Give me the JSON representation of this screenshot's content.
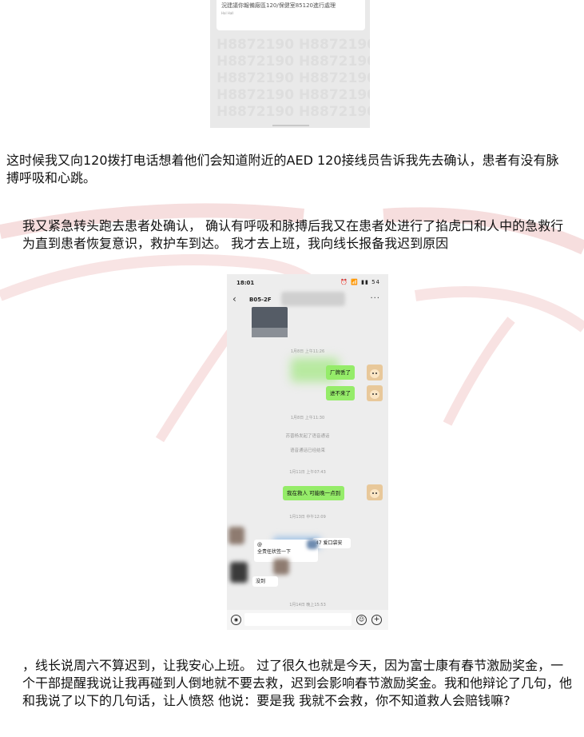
{
  "top_screenshot": {
    "card_text": "況建議你報備廠區120/保健室85120進行處理",
    "card_small": "Hal Hall",
    "watermark_lines": [
      "H8872190  H8872190",
      "H8872190  H8872190",
      "H8872190  H8872190",
      "H8872190  H8872190",
      "H8872190  H8872190"
    ]
  },
  "paragraphs": {
    "p1": "这时候我又向120拨打电话想着他们会知道附近的AED 120接线员告诉我先去确认，患者有没有脉搏呼吸和心跳。",
    "p2": "我又紧急转头跑去患者处确认， 确认有呼吸和脉搏后我又在患者处进行了掐虎口和人中的急救行为直到患者恢复意识，救护车到达。 我才去上班，我向线长报备我迟到原因",
    "p3": "，线长说周六不算迟到，让我安心上班。 过了很久也就是今天，因为富士康有春节激励奖金，一个干部提醒我说让我再碰到人倒地就不要去救，迟到会影响春节激励奖金。我和他辩论了几句，他和我说了以下的几句话，让人愤怒 他说：要是我 我就不会救，你不知道救人会赔钱嘛?"
  },
  "phone": {
    "status_time": "18:01",
    "status_icons": "⏰ 📶 ▮▮ 54",
    "chat_title": "B05-2F",
    "back_icon": "back-arrow-icon",
    "more_icon": "more-icon",
    "timestamps": [
      "1月8日 上午11:26",
      "1月8日 上午11:30",
      "1月11日 上午07:43",
      "1月13日 中午12:09",
      "1月14日 晚上15:53"
    ],
    "messages": {
      "m1": "厂牌丢了",
      "m2": "进不来了",
      "m3": "我在救人 可能晚一点到",
      "sys1": "苏晋杨发起了语音通话",
      "sys2": "语音通话已经结束",
      "w1a": "@",
      "w1b": "全责任状签一下",
      "w2": "47 爱口袋安",
      "w3": "没到"
    }
  },
  "colors": {
    "accent_green": "#95ec69",
    "chat_bg": "#ededed",
    "watermark_red": "#f3d6d6"
  }
}
